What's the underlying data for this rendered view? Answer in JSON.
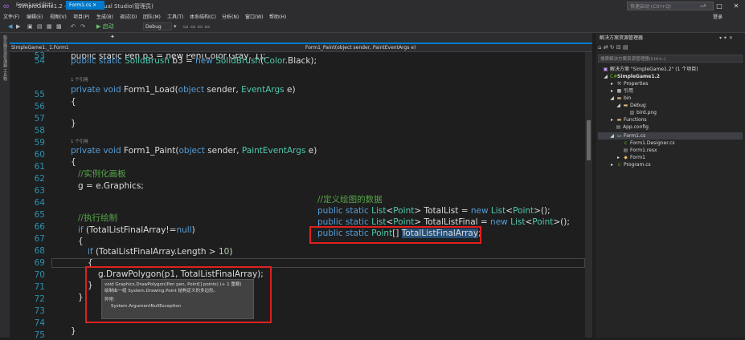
{
  "window": {
    "title": "SimpleGame1.2 - Microsoft Visual Studio(管理员)",
    "quick_launch_placeholder": "快速启动 (Ctrl+Q)",
    "login": "登录",
    "minimize": "–",
    "maximize": "□",
    "close": "✕"
  },
  "menu": [
    "文件(F)",
    "编辑(E)",
    "视图(V)",
    "项目(P)",
    "生成(B)",
    "调试(D)",
    "团队(M)",
    "工具(T)",
    "体系结构(C)",
    "分析(N)",
    "窗口(W)",
    "帮助(H)"
  ],
  "toolbar": {
    "start_label": "▶ 启动",
    "config": "Debug"
  },
  "left_strip": "服务器资源管理器 工具箱",
  "tabs": [
    {
      "label": "Form1.cs [设计]"
    },
    {
      "label": "Form1.cs  ✕"
    }
  ],
  "navbar": {
    "left": "SimpleGame1._1.Form1",
    "right": "Form1_Paint(object sender, PaintEventArgs e)"
  },
  "editor": {
    "line_numbers": [
      "53",
      "54",
      "55",
      "56",
      "57",
      "58",
      "59",
      "60",
      "61",
      "62",
      "63",
      "64",
      "65",
      "66",
      "67",
      "68",
      "69",
      "70",
      "71",
      "72",
      "73",
      "74",
      "75",
      "76"
    ],
    "ref_hint": "1 个引用",
    "code": {
      "l53": "public static Pen p3 = new Pen(Color.Gray, 1);",
      "l54_a": "public static ",
      "l54_b": "SolidBrush",
      "l54_c": " b3 = ",
      "l54_d": "new ",
      "l54_e": "SolidBrush",
      "l54_f": "(",
      "l54_g": "Color",
      "l54_h": ".Black);",
      "l55_a": "private void ",
      "l55_b": "Form1_Load(",
      "l55_c": "object",
      "l55_d": " sender, ",
      "l55_e": "EventArgs",
      "l55_f": " e)",
      "brace_open": "{",
      "brace_close": "}",
      "l60_a": "private void ",
      "l60_b": "Form1_Paint(",
      "l60_c": "object",
      "l60_d": " sender, ",
      "l60_e": "PaintEventArgs",
      "l60_f": " e)",
      "l62": "//实例化画板",
      "l63": "g = e.Graphics;",
      "l66": "//执行绘制",
      "l67_a": "if",
      "l67_b": " (TotalListFinalArray!=",
      "l67_c": "null",
      "l67_d": ")",
      "l69_a": "if",
      "l69_b": " (TotalListFinalArray.Length > ",
      "l69_c": "10",
      "l69_d": ")",
      "l71": "g.DrawPolygon(p1, TotalListFinalArray);"
    },
    "overlay": {
      "comment": "//定义绘图的数据",
      "line1_a": "public static ",
      "line1_b": "List",
      "line1_c": "<",
      "line1_d": "Point",
      "line1_e": "> TotalList = ",
      "line1_f": "new ",
      "line1_g": "List",
      "line1_h": "<",
      "line1_i": "Point",
      "line1_j": ">();",
      "line2_e": "> TotalListFinal = ",
      "line3_a": "public static ",
      "line3_b": "Point",
      "line3_c": "[] ",
      "line3_d": "TotalListFinalArray",
      "line3_e": ";"
    },
    "tooltip": {
      "sig": "void Graphics.DrawPolygon(Pen pen, Point[] points)  (+ 1 重载)",
      "desc": "绘制由一组 System.Drawing.Point 结构定义的多边形。",
      "exc_label": "异常:",
      "exc": "System.ArgumentNullException"
    }
  },
  "solution_explorer": {
    "title": "解决方案资源管理器",
    "search_placeholder": "搜索解决方案资源管理器(Ctrl+;)",
    "items": [
      {
        "label": "解决方案 \"SimpleGame1.2\" (1 个项目)",
        "icon": "solution-icon"
      },
      {
        "label": "SimpleGame1.2",
        "icon": "csharp-project-icon"
      },
      {
        "label": "Properties",
        "icon": "wrench-icon"
      },
      {
        "label": "引用",
        "icon": "references-icon"
      },
      {
        "label": "bin",
        "icon": "folder-icon"
      },
      {
        "label": "Debug",
        "icon": "folder-icon"
      },
      {
        "label": "bird.png",
        "icon": "image-file-icon"
      },
      {
        "label": "Functions",
        "icon": "folder-icon"
      },
      {
        "label": "App.config",
        "icon": "config-file-icon"
      },
      {
        "label": "Form1.cs",
        "icon": "form-icon"
      },
      {
        "label": "Form1.Designer.cs",
        "icon": "cs-file-icon"
      },
      {
        "label": "Form1.resx",
        "icon": "resx-file-icon"
      },
      {
        "label": "Form1",
        "icon": "class-icon"
      },
      {
        "label": "Program.cs",
        "icon": "cs-file-icon"
      }
    ]
  },
  "colors": {
    "accent": "#007acc",
    "keyword": "#569cd6",
    "type": "#4ec9b0",
    "comment": "#57a64a",
    "highlight_box": "#e02020"
  }
}
